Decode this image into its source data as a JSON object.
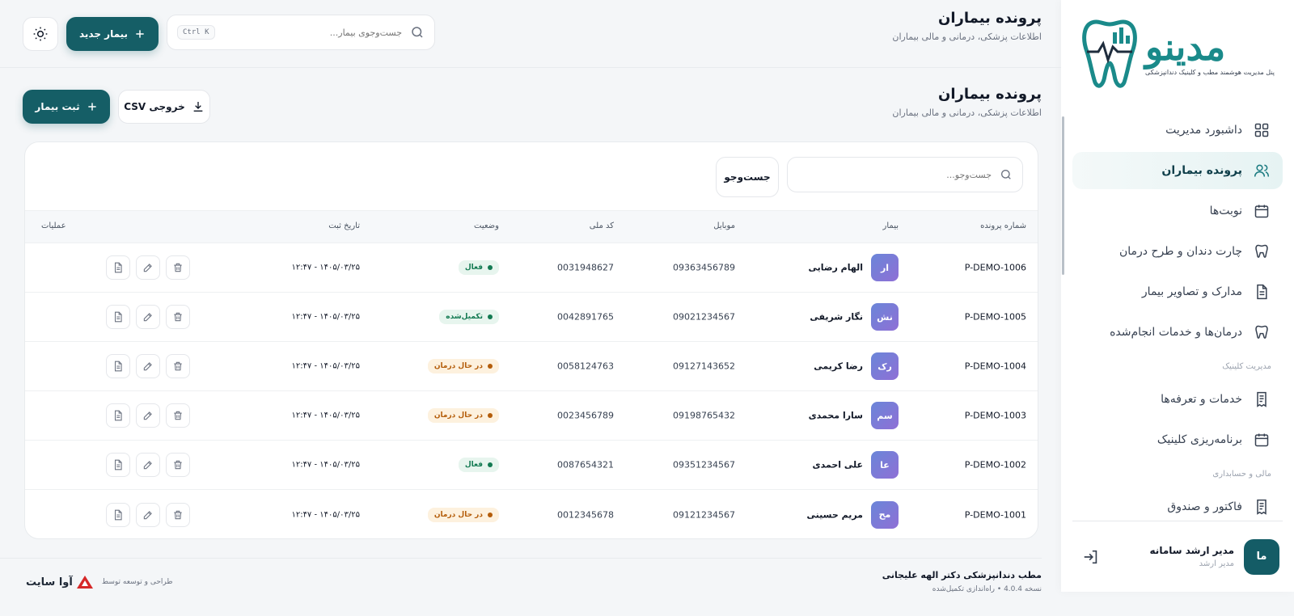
{
  "brand": {
    "logo_text": "مدینو",
    "tagline": "پنل مدیریت هوشمند مطب و کلینیک دندانپزشکی"
  },
  "sidebar": {
    "items": [
      {
        "label": "داشبورد مدیریت",
        "icon": "grid-icon"
      },
      {
        "label": "پرونده بیماران",
        "icon": "users-icon",
        "active": true
      },
      {
        "label": "نوبت‌ها",
        "icon": "calendar-icon"
      },
      {
        "label": "چارت دندان و طرح درمان",
        "icon": "tooth-icon"
      },
      {
        "label": "مدارک و تصاویر بیمار",
        "icon": "document-icon"
      },
      {
        "label": "درمان‌ها و خدمات انجام‌شده",
        "icon": "tooth-icon"
      }
    ],
    "section_clinic": "مدیریت کلینیک",
    "clinic_items": [
      {
        "label": "خدمات و تعرفه‌ها",
        "icon": "receipt-icon"
      },
      {
        "label": "برنامه‌ریزی کلینیک",
        "icon": "calendar-icon"
      }
    ],
    "section_finance": "مالی و حسابداری",
    "finance_items": [
      {
        "label": "فاکتور و صندوق",
        "icon": "receipt-icon"
      }
    ],
    "user": {
      "initials": "ما",
      "name": "مدیر ارشد سامانه",
      "role": "مدیر ارشد"
    }
  },
  "topbar": {
    "title": "پرونده بیماران",
    "subtitle": "اطلاعات پزشکی، درمانی و مالی بیماران",
    "search_placeholder": "جست‌وجوی بیمار...",
    "shortcut": "Ctrl K",
    "new_patient_label": "بیمار جدید"
  },
  "page": {
    "title": "پرونده بیماران",
    "subtitle": "اطلاعات پزشکی، درمانی و مالی بیماران",
    "add_label": "ثبت بیمار",
    "csv_label": "خروجی CSV"
  },
  "table": {
    "search_placeholder": "جست‌وجو...",
    "search_button": "جست‌وجو",
    "headers": {
      "file": "شماره پرونده",
      "patient": "بیمار",
      "mobile": "موبایل",
      "national": "کد ملی",
      "status": "وضعیت",
      "date": "تاریخ ثبت",
      "ops": "عملیات"
    },
    "rows": [
      {
        "file": "P-DEMO-1006",
        "initials": "ار",
        "name": "الهام رضایی",
        "mobile": "09363456789",
        "national": "0031948627",
        "status": "فعال",
        "status_color": "#137a52",
        "date": "۱۴۰۵/۰۳/۲۵ - ۱۲:۴۷"
      },
      {
        "file": "P-DEMO-1005",
        "initials": "نش",
        "name": "نگار شریفی",
        "mobile": "09021234567",
        "national": "0042891765",
        "status": "تکمیل‌شده",
        "status_color": "#137a52",
        "date": "۱۴۰۵/۰۳/۲۵ - ۱۲:۴۷"
      },
      {
        "file": "P-DEMO-1004",
        "initials": "رک",
        "name": "رضا کریمی",
        "mobile": "09127143652",
        "national": "0058124763",
        "status": "در حال درمان",
        "status_color": "#b45d0a",
        "date": "۱۴۰۵/۰۳/۲۵ - ۱۲:۴۷"
      },
      {
        "file": "P-DEMO-1003",
        "initials": "سم",
        "name": "سارا محمدی",
        "mobile": "09198765432",
        "national": "0023456789",
        "status": "در حال درمان",
        "status_color": "#b45d0a",
        "date": "۱۴۰۵/۰۳/۲۵ - ۱۲:۴۷"
      },
      {
        "file": "P-DEMO-1002",
        "initials": "عا",
        "name": "علی احمدی",
        "mobile": "09351234567",
        "national": "0087654321",
        "status": "فعال",
        "status_color": "#137a52",
        "date": "۱۴۰۵/۰۳/۲۵ - ۱۲:۴۷"
      },
      {
        "file": "P-DEMO-1001",
        "initials": "مح",
        "name": "مریم حسینی",
        "mobile": "09121234567",
        "national": "0012345678",
        "status": "در حال درمان",
        "status_color": "#b45d0a",
        "date": "۱۴۰۵/۰۳/۲۵ - ۱۲:۴۷"
      }
    ]
  },
  "footer": {
    "clinic": "مطب دندانپزشکی دکتر الهه علیجانی",
    "version": "نسخه 4.0.4 • راه‌اندازی تکمیل‌شده",
    "by": "طراحی و توسعه توسط",
    "brand": "آوا سایت"
  },
  "colors": {
    "primary": "#155e66",
    "accent": "#1a8a8a",
    "status_green": "#137a52",
    "status_orange": "#b45d0a"
  }
}
